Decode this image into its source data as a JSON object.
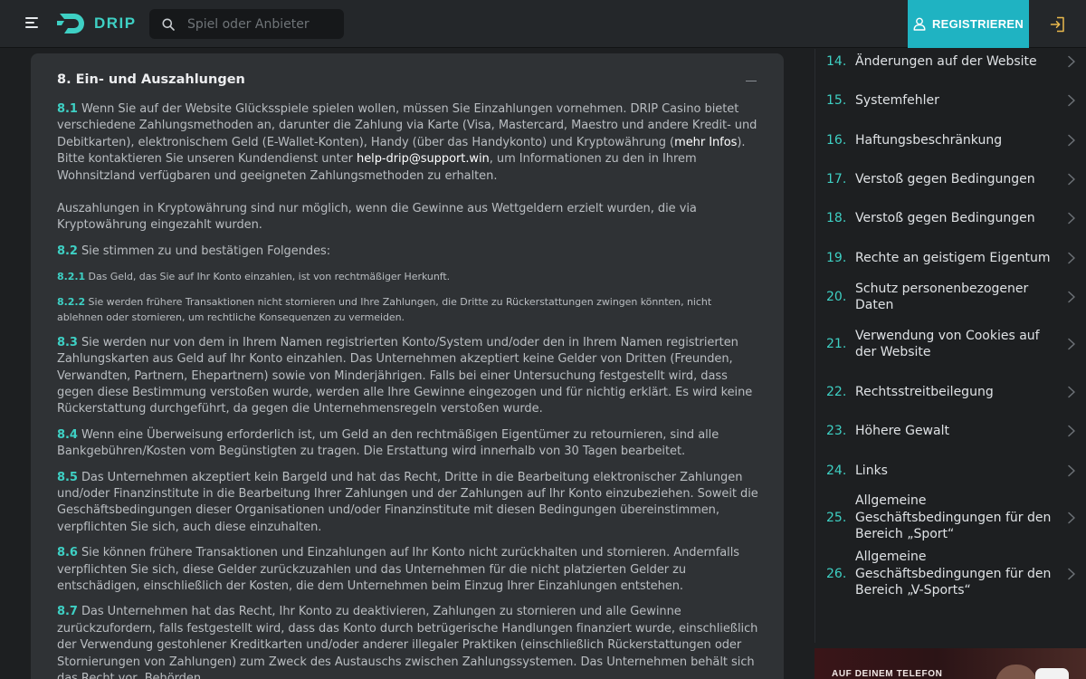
{
  "header": {
    "brand": "DRIP",
    "search_placeholder": "Spiel oder Anbieter",
    "register_label": "REGISTRIEREN",
    "accent_color": "#3ed0c4",
    "register_color": "#1fb3c2"
  },
  "section": {
    "title": "8. Ein- und Auszahlungen",
    "p81": {
      "num": "8.1",
      "t1": " Wenn Sie auf der Website Glücksspiele spielen wollen, müssen Sie Einzahlungen vornehmen. DRIP Casino bietet verschiedene Zahlungsmethoden an, darunter die Zahlung via Karte (Visa, Mastercard, Maestro und andere Kredit- und Debitkarten), elektronischem Geld (E-Wallet-Konten), Handy (über das Handykonto) und Kryptowährung (",
      "link1": "mehr Infos",
      "t2": "). Bitte kontaktieren Sie unseren Kundendienst unter ",
      "link2": "help-drip@support.win",
      "t3": ", um Informationen zu den in Ihrem Wohnsitzland verfügbaren und geeigneten Zahlungsmethoden zu erhalten."
    },
    "p81b": "Auszahlungen in Kryptowährung sind nur möglich, wenn die Gewinne aus Wettgeldern erzielt wurden, die via Kryptowährung eingezahlt wurden.",
    "p82": {
      "num": "8.2",
      "text": " Sie stimmen zu und bestätigen Folgendes:"
    },
    "p821": {
      "num": "8.2.1",
      "text": " Das Geld, das Sie auf Ihr Konto einzahlen, ist von rechtmäßiger Herkunft."
    },
    "p822": {
      "num": "8.2.2",
      "text": " Sie werden frühere Transaktionen nicht stornieren und Ihre Zahlungen, die Dritte zu Rückerstattungen zwingen könnten, nicht ablehnen oder stornieren, um rechtliche Konsequenzen zu vermeiden."
    },
    "p83": {
      "num": "8.3",
      "text": " Sie werden nur von dem in Ihrem Namen registrierten Konto/System und/oder den in Ihrem Namen registrierten Zahlungskarten aus Geld auf Ihr Konto einzahlen. Das Unternehmen akzeptiert keine Gelder von Dritten (Freunden, Verwandten, Partnern, Ehepartnern) sowie von Minderjährigen. Falls bei einer Untersuchung festgestellt wird, dass gegen diese Bestimmung verstoßen wurde, werden alle Ihre Gewinne eingezogen und für nichtig erklärt. Es wird keine Rückerstattung durchgeführt, da gegen die Unternehmensregeln verstoßen wurde."
    },
    "p84": {
      "num": "8.4",
      "text": " Wenn eine Überweisung erforderlich ist, um Geld an den rechtmäßigen Eigentümer zu retournieren, sind alle Bankgebühren/Kosten vom Begünstigten zu tragen. Die Erstattung wird innerhalb von 30 Tagen bearbeitet."
    },
    "p85": {
      "num": "8.5",
      "text": " Das Unternehmen akzeptiert kein Bargeld und hat das Recht, Dritte in die Bearbeitung elektronischer Zahlungen und/oder Finanzinstitute in die Bearbeitung Ihrer Zahlungen und der Zahlungen auf Ihr Konto einzubeziehen. Soweit die Geschäftsbedingungen dieser Organisationen und/oder Finanzinstitute mit diesen Bedingungen übereinstimmen, verpflichten Sie sich, auch diese einzuhalten."
    },
    "p86": {
      "num": "8.6",
      "text": " Sie können frühere Transaktionen und Einzahlungen auf Ihr Konto nicht zurückhalten und stornieren. Andernfalls verpflichten Sie sich, diese Gelder zurückzuzahlen und das Unternehmen für die nicht platzierten Gelder zu entschädigen, einschließlich der Kosten, die dem Unternehmen beim Einzug Ihrer Einzahlungen entstehen."
    },
    "p87": {
      "num": "8.7",
      "text": " Das Unternehmen hat das Recht, Ihr Konto zu deaktivieren, Zahlungen zu stornieren und alle Gewinne zurückzufordern, falls festgestellt wird, dass das Konto durch betrügerische Handlungen finanziert wurde, einschließlich der Verwendung gestohlener Kreditkarten und/oder anderer illegaler Praktiken (einschließlich Rückerstattungen oder Stornierungen von Zahlungen) zum Zweck des Austauschs zwischen Zahlungssystemen. Das Unternehmen behält sich das Recht vor, Behörden"
    }
  },
  "toc": [
    {
      "num": "14.",
      "label": "Änderungen auf der Website"
    },
    {
      "num": "15.",
      "label": "Systemfehler"
    },
    {
      "num": "16.",
      "label": "Haftungsbeschränkung"
    },
    {
      "num": "17.",
      "label": "Verstoß gegen Bedingungen"
    },
    {
      "num": "18.",
      "label": "Verstoß gegen Bedingungen"
    },
    {
      "num": "19.",
      "label": "Rechte an geistigem Eigentum"
    },
    {
      "num": "20.",
      "label": "Schutz personenbezogener Daten"
    },
    {
      "num": "21.",
      "label": "Verwendung von Cookies auf der Website"
    },
    {
      "num": "22.",
      "label": "Rechtsstreitbeilegung"
    },
    {
      "num": "23.",
      "label": "Höhere Gewalt"
    },
    {
      "num": "24.",
      "label": "Links"
    },
    {
      "num": "25.",
      "label": "Allgemeine Geschäftsbedingungen für den Bereich „Sport“"
    },
    {
      "num": "26.",
      "label": "Allgemeine Geschäftsbedingungen für den Bereich „V-Sports“"
    }
  ],
  "promo": {
    "text": "AUF DEINEM TELEFON"
  }
}
